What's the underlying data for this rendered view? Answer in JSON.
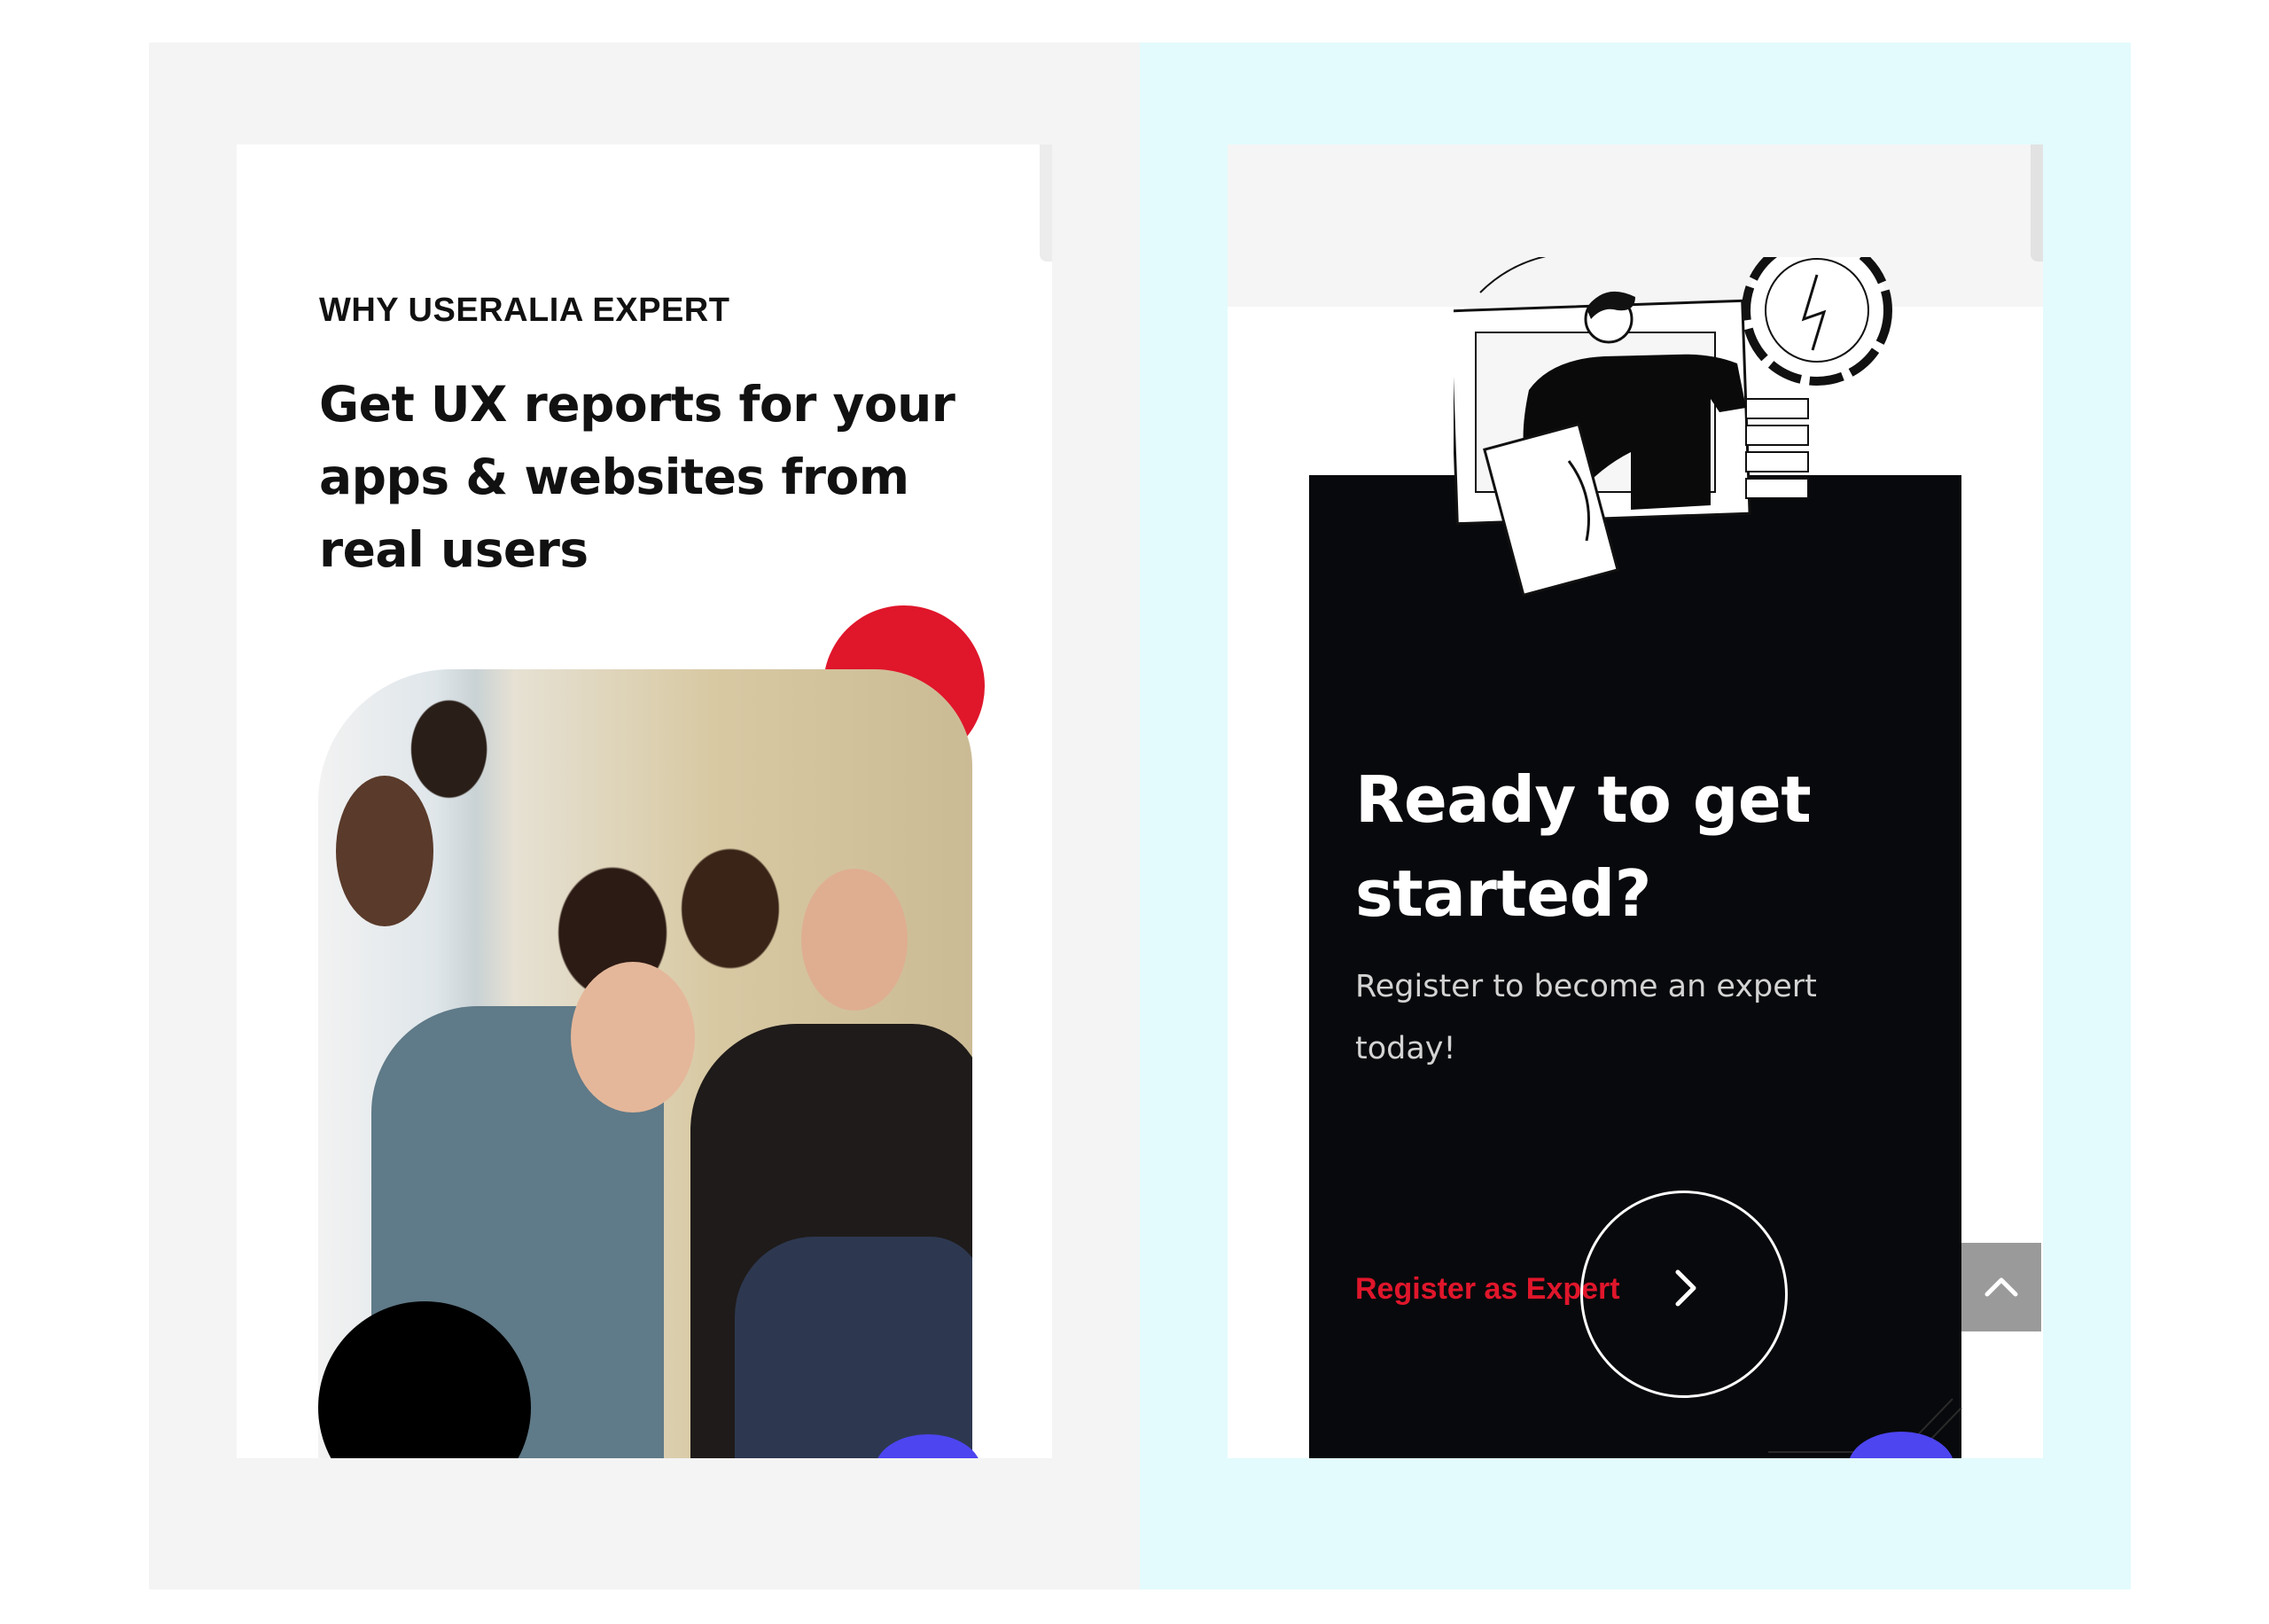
{
  "left_screen": {
    "eyebrow": "WHY USERALIA EXPERT",
    "headline": "Get UX reports for your apps & websites from real users",
    "photo_alt": "Team of four people looking at a laptop",
    "accent_colors": {
      "red": "#e0162b",
      "black": "#000000",
      "blue": "#4d45f0"
    }
  },
  "right_screen": {
    "title": "Ready to get started?",
    "subtitle": "Register to become an expert today!",
    "cta_label": "Register as Expert",
    "cta_icon": "chevron-right-icon",
    "back_to_top_icon": "chevron-up-icon",
    "illustration": "person-with-dashboard-illustration",
    "colors": {
      "card": "#08090c",
      "cta": "#e0162b",
      "background": "#e3fbfd"
    }
  }
}
